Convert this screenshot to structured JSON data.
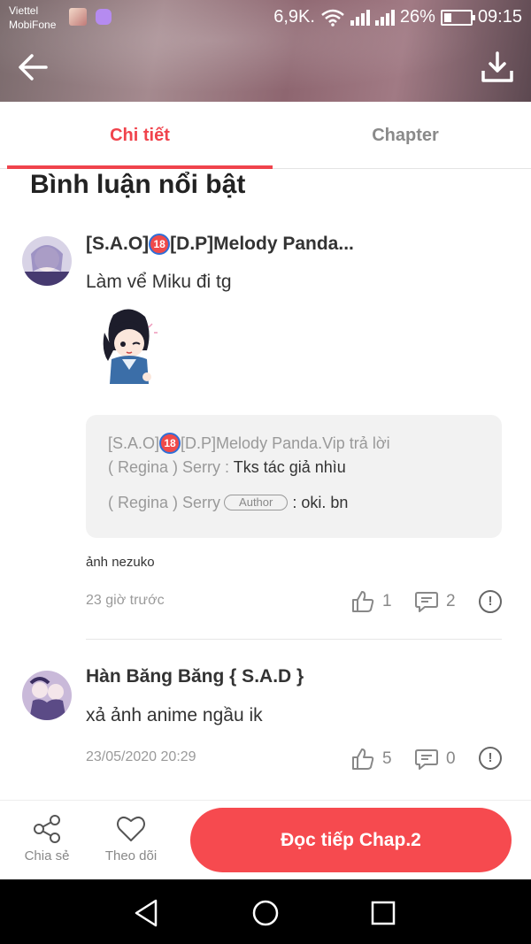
{
  "status_bar": {
    "carrier1": "Viettel",
    "carrier2": "MobiFone",
    "speed": "6,9K.",
    "battery": "26%",
    "time": "09:15"
  },
  "tabs": {
    "details": "Chi tiết",
    "chapter": "Chapter"
  },
  "section_title": "Bình luận nổi bật",
  "comments": [
    {
      "user_prefix": "[S.A.O]",
      "badge": "18",
      "user_suffix": "[D.P]Melody Panda...",
      "text": "Làm vể Miku đi tg",
      "reply": {
        "head_prefix": "[S.A.O]",
        "head_suffix": "[D.P]Melody Panda.Vip trả lời",
        "lines": [
          {
            "user": "( Regina ) Serry :",
            "message": " Tks tác giả nhìu"
          },
          {
            "user": "( Regina ) Serry",
            "badge": "Author",
            "message": " : oki. bn"
          }
        ]
      },
      "extra": "ảnh nezuko",
      "time": "23 giờ trước",
      "likes": "1",
      "replies": "2"
    },
    {
      "user": "Hàn Băng Băng { S.A.D }",
      "text": "xả ảnh anime ngầu ik",
      "time": "23/05/2020 20:29",
      "likes": "5",
      "replies": "0"
    }
  ],
  "bottom_bar": {
    "share": "Chia sẻ",
    "follow": "Theo dõi",
    "read_button": "Đọc tiếp Chap.2"
  },
  "colors": {
    "accent": "#f0434c",
    "button": "#f64a4f"
  }
}
